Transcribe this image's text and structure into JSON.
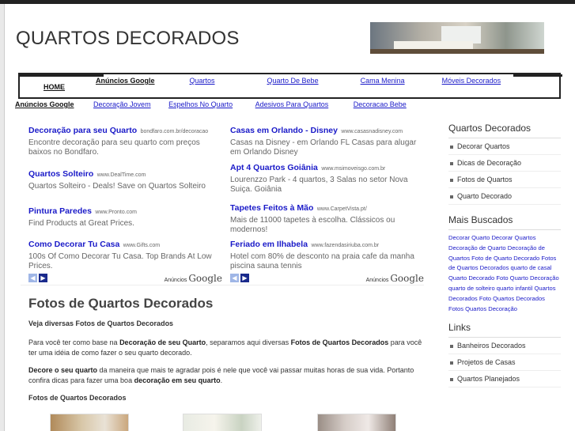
{
  "header": {
    "title": "QUARTOS DECORADOS"
  },
  "nav": {
    "home": "HOME",
    "ads_label": "Anúncios Google",
    "links": [
      "Quartos",
      "Quarto De Bebe",
      "Cama Menina",
      "Móveis Decorados"
    ],
    "row2_label": "Anúncios Google",
    "row2_links": [
      "Decoração Jovem",
      "Espelhos No Quarto",
      "Adesivos Para Quartos",
      "Decoracao Bebe"
    ]
  },
  "ads": {
    "left": [
      {
        "title": "Decoração para seu Quarto",
        "url": "bondfaro.com.br/decoracao",
        "desc": "Encontre decoração para seu quarto com preços baixos no Bondfaro."
      },
      {
        "title": "Quartos Solteiro",
        "url": "www.DealTime.com",
        "desc": "Quartos Solteiro - Deals! Save on Quartos Solteiro"
      },
      {
        "title": "Pintura Paredes",
        "url": "www.Pronto.com",
        "desc": "Find Products at Great Prices."
      },
      {
        "title": "Como Decorar Tu Casa",
        "url": "www.Gifts.com",
        "desc": "100s Of Como Decorar Tu Casa. Top Brands At Low Prices."
      }
    ],
    "right": [
      {
        "title": "Casas em Orlando - Disney",
        "url": "www.casasnadisney.com",
        "desc": "Casas na Disney - em Orlando FL Casas para alugar em Orlando Disney"
      },
      {
        "title": "Apt 4 Quartos Goiânia",
        "url": "www.msimoveisgo.com.br",
        "desc": "Lourenzzo Park - 4 quartos, 3 Salas no setor Nova Suiça. Goiânia"
      },
      {
        "title": "Tapetes Feitos à Mão",
        "url": "www.CarpetVista.pt/",
        "desc": "Mais de 11000 tapetes à escolha. Clássicos ou modernos!"
      },
      {
        "title": "Feriado em Ilhabela",
        "url": "www.fazendasiriuba.com.br",
        "desc": "Hotel com 80% de desconto na praia cafe da manha piscina sauna tennis"
      }
    ],
    "footer_label": "Anúncios",
    "footer_brand": "Google"
  },
  "main": {
    "heading": "Fotos de Quartos Decorados",
    "intro": "Veja diversas Fotos de Quartos Decorados",
    "p1": {
      "a": "Para você ter como base na ",
      "b": "Decoração de seu Quarto",
      "c": ", separamos aqui diversas ",
      "d": "Fotos de Quartos Decorados",
      "e": " para você ter uma idéia de como fazer o seu quarto decorado."
    },
    "p2": {
      "a": "Decore o seu quarto",
      "b": " da maneira que mais te agradar pois é nele que você vai passar muitas horas de sua vida. Portanto confira dicas para fazer uma boa ",
      "c": "decoração em seu quarto",
      "d": "."
    },
    "subheading": "Fotos de Quartos Decorados"
  },
  "sidebar": {
    "section1_title": "Quartos Decorados",
    "section1_items": [
      "Decorar Quartos",
      "Dicas de Decoração",
      "Fotos de Quartos",
      "Quarto Decorado"
    ],
    "section2_title": "Mais Buscados",
    "tags": "Decorar Quarto Decorar Quartos Decoração de Quarto Decoração de Quartos Foto de Quarto Decorado Fotos de Quartos Decorados quarto de casal Quarto Decorado Foto Quarto Decoração quarto de solteiro quarto infantil Quartos Decorados Foto Quartos Decorados Fotos Quartos Decoração",
    "section3_title": "Links",
    "section3_items": [
      "Banheiros Decorados",
      "Projetos de Casas",
      "Quartos Planejados"
    ]
  },
  "colors": {
    "link": "#1a1ac8",
    "arrow_dark": "#1a2a8c",
    "arrow_light": "#9fb6e6"
  }
}
